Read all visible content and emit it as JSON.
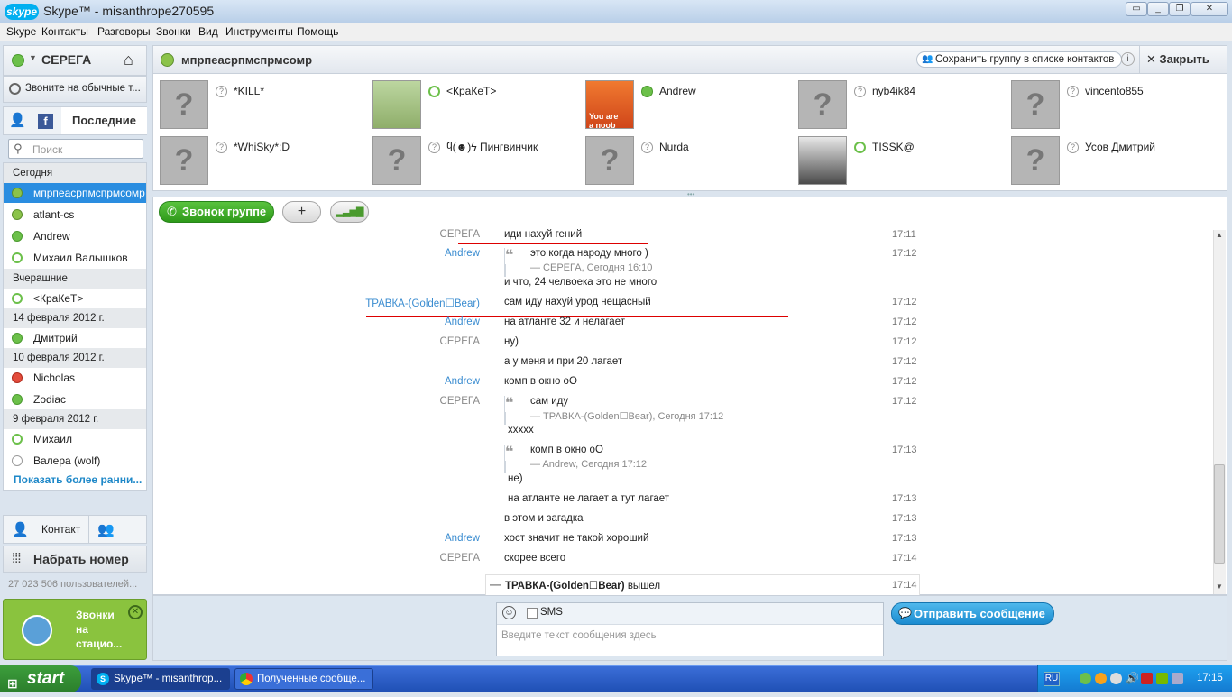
{
  "window": {
    "logo": "skype",
    "title": "Skype™ - misanthrope270595",
    "controls": [
      "restore-alt-icon",
      "minimize-icon",
      "maximize-icon",
      "close-icon"
    ]
  },
  "menu": [
    "Skype",
    "Контакты",
    "Разговоры",
    "Звонки",
    "Вид",
    "Инструменты",
    "Помощь"
  ],
  "sidebar": {
    "user_name": "СЕРЕГА",
    "call_phones": "Звоните на обычные т...",
    "tab_recent": "Последние",
    "search_placeholder": "Поиск",
    "groups": [
      {
        "header": "Сегодня",
        "items": [
          {
            "name": "мпрпеасрпмспрмсомр",
            "status": "group",
            "selected": true
          },
          {
            "name": "atlant-cs",
            "status": "group"
          },
          {
            "name": "Andrew",
            "status": "online"
          },
          {
            "name": "Михаил Валышков",
            "status": "offline"
          }
        ]
      },
      {
        "header": "Вчерашние",
        "items": [
          {
            "name": "<КраКеТ>",
            "status": "offline"
          }
        ]
      },
      {
        "header": "14 февраля 2012 г.",
        "items": [
          {
            "name": "Дмитрий",
            "status": "online"
          }
        ]
      },
      {
        "header": "10 февраля 2012 г.",
        "items": [
          {
            "name": "Nicholas",
            "status": "busy"
          },
          {
            "name": "Zodiac",
            "status": "online"
          }
        ]
      },
      {
        "header": "9 февраля 2012 г.",
        "items": [
          {
            "name": "Михаил",
            "status": "offline"
          },
          {
            "name": "Валера (wolf)",
            "status": "unknown"
          }
        ]
      }
    ],
    "show_more": "Показать более ранни...",
    "add_contact": "Контакт",
    "dial": "Набрать номер",
    "users_online": "27 023 506 пользователей...",
    "promo": [
      "Звонки",
      "на",
      "стацио..."
    ]
  },
  "group": {
    "name": "мпрпеасрпмспрмсомр",
    "save_group": "Сохранить группу в списке контактов",
    "close": "Закрыть",
    "members": [
      {
        "name": "*KILL*",
        "status": "unknown",
        "avatar": "placeholder"
      },
      {
        "name": "<КраКеТ>",
        "status": "offline",
        "avatar": "photo-outdoor"
      },
      {
        "name": "Andrew",
        "status": "online",
        "avatar": "you-are-a-noob",
        "avatar_text": [
          "You are",
          "a noob"
        ]
      },
      {
        "name": "nyb4ik84",
        "status": "unknown",
        "avatar": "placeholder"
      },
      {
        "name": "vincento855",
        "status": "unknown",
        "avatar": "placeholder"
      },
      {
        "name": "*WhiSky*:D",
        "status": "unknown",
        "avatar": "placeholder"
      },
      {
        "name": "ϥ(☻)ϟ Пингвинчик",
        "status": "unknown",
        "avatar": "placeholder"
      },
      {
        "name": "Nurda",
        "status": "unknown",
        "avatar": "placeholder"
      },
      {
        "name": "TISSK@",
        "status": "offline",
        "avatar": "photo-person"
      },
      {
        "name": "Усов Дмитрий",
        "status": "unknown",
        "avatar": "placeholder"
      }
    ]
  },
  "toolbar": {
    "call_group": "Звонок группе",
    "add": "+",
    "quality": "signal-bars-icon"
  },
  "messages": [
    {
      "who": "СЕРЕГА",
      "author": "me",
      "text": "иди нахуй гений",
      "time": "17:11"
    },
    {
      "who": "Andrew",
      "author": "other",
      "quote": "это когда народу много )",
      "quote_src": "— СЕРЕГА, Сегодня 16:10",
      "time": "17:12"
    },
    {
      "who": "",
      "text": "и что, 24 челвоека это не много",
      "time": ""
    },
    {
      "who": "ТРАВКА-(Golden☐Bear)",
      "author": "other",
      "text": "сам иду нахуй урод нещасный",
      "time": "17:12"
    },
    {
      "who": "Andrew",
      "author": "other",
      "text": "на атланте 32 и нелагает",
      "time": "17:12"
    },
    {
      "who": "СЕРЕГА",
      "author": "me",
      "text": "ну)",
      "time": "17:12"
    },
    {
      "who": "",
      "text": "а у меня и при 20 лагает",
      "time": "17:12"
    },
    {
      "who": "Andrew",
      "author": "other",
      "text": "комп в окно оО",
      "time": "17:12"
    },
    {
      "who": "СЕРЕГА",
      "author": "me",
      "quote": "сам иду",
      "quote_src": "— ТРАВКА-(Golden☐Bear), Сегодня 17:12",
      "time": "17:12"
    },
    {
      "who": "",
      "text": "xxxxx",
      "time": ""
    },
    {
      "who": "",
      "quote": "комп в окно оО",
      "quote_src": "— Andrew, Сегодня 17:12",
      "time": "17:13"
    },
    {
      "who": "",
      "text": "не)",
      "time": ""
    },
    {
      "who": "",
      "text": "на атланте не лагает а тут лагает",
      "time": "17:13"
    },
    {
      "who": "",
      "text": "в этом и загадка",
      "time": "17:13"
    },
    {
      "who": "Andrew",
      "author": "other",
      "text": "хост значит не такой хороший",
      "time": "17:13"
    },
    {
      "who": "СЕРЕГА",
      "author": "me",
      "text": "скорее всего",
      "time": "17:14"
    }
  ],
  "left_event": {
    "name": "ТРАВКА-(Golden☐Bear)",
    "text": "вышел",
    "time": "17:14"
  },
  "compose": {
    "sms": "SMS",
    "placeholder": "Введите текст сообщения здесь",
    "send": "Отправить сообщение"
  },
  "taskbar": {
    "start": "start",
    "tasks": [
      "Skype™ - misanthrop...",
      "Полученные сообще..."
    ],
    "lang": "RU",
    "clock": "17:15"
  },
  "colors": {
    "accent": "#2a8de0",
    "online": "#6cc04a",
    "busy": "#e34c3c",
    "call_green": "#2e9a1a",
    "send_blue": "#1b8bd0"
  }
}
